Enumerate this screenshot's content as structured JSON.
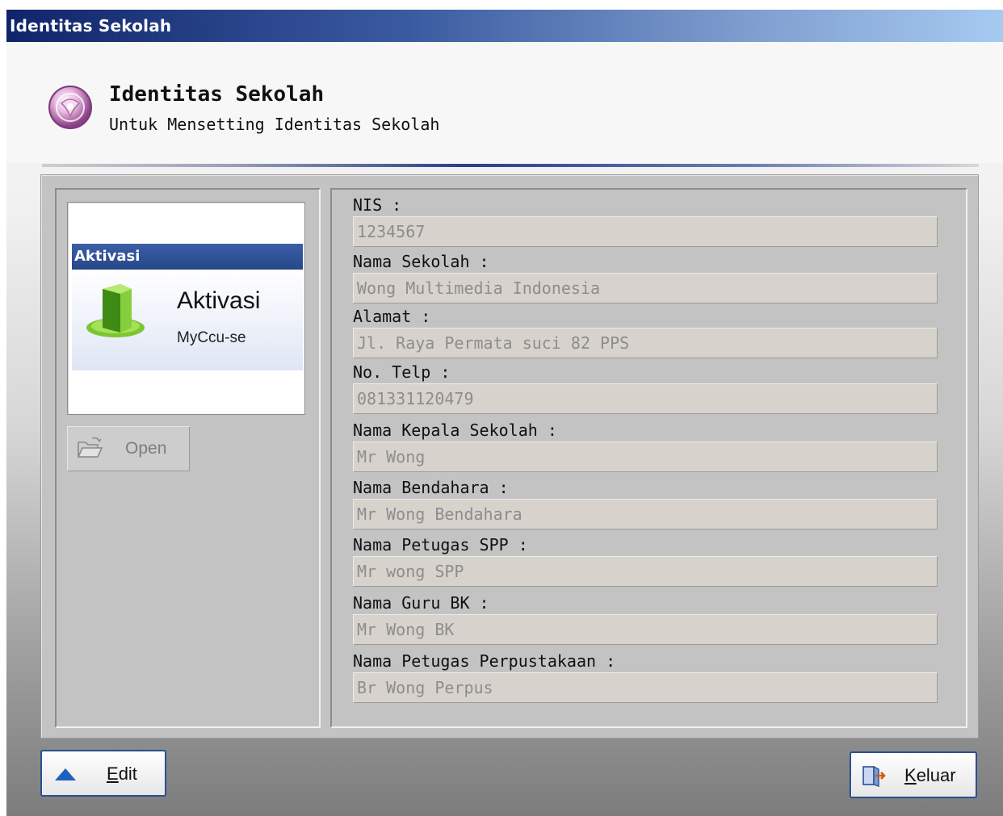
{
  "window": {
    "title": "Identitas Sekolah"
  },
  "header": {
    "title": "Identitas Sekolah",
    "subtitle": "Untuk Mensetting Identitas Sekolah",
    "icon": "school-identity-icon"
  },
  "image_preview": {
    "strip_label": "Aktivasi",
    "big_text": "Aktivasi",
    "small_text": "MyCcu-se"
  },
  "open_button": {
    "label": "Open",
    "icon": "folder-open-icon"
  },
  "fields": [
    {
      "label": "NIS :",
      "value": "1234567"
    },
    {
      "label": "Nama Sekolah :",
      "value": "Wong Multimedia Indonesia"
    },
    {
      "label": "Alamat :",
      "value": "Jl. Raya Permata suci 82 PPS"
    },
    {
      "label": "No. Telp :",
      "value": "081331120479"
    },
    {
      "label": "Nama Kepala Sekolah :",
      "value": "Mr Wong"
    },
    {
      "label": "Nama Bendahara :",
      "value": "Mr Wong Bendahara"
    },
    {
      "label": "Nama Petugas SPP :",
      "value": "Mr wong SPP"
    },
    {
      "label": "Nama Guru BK :",
      "value": "Mr Wong BK"
    },
    {
      "label": "Nama Petugas Perpustakaan :",
      "value": "Br Wong Perpus"
    }
  ],
  "buttons": {
    "edit": {
      "mnemonic": "E",
      "rest": "dit",
      "icon": "arrow-up-icon"
    },
    "keluar": {
      "mnemonic": "K",
      "rest": "eluar",
      "icon": "exit-door-icon"
    }
  }
}
